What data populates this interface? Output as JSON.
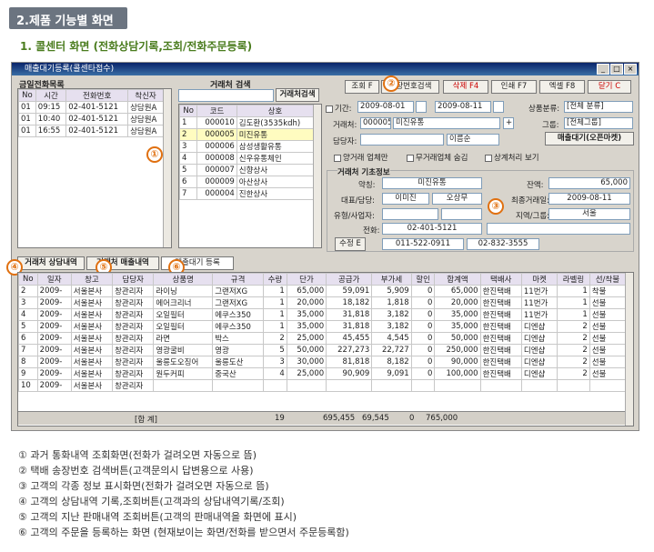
{
  "header": "2.제품 기능별 화면",
  "subtitle": "1. 콜센터 화면 (전화상담기록,조회/전화주문등록)",
  "window": {
    "title": "매출대기등록(콜센타접수)"
  },
  "calls": {
    "title": "금일전화목록",
    "cols": [
      "No",
      "시간",
      "전화번호",
      "착신자"
    ],
    "rows": [
      [
        "01",
        "09:15",
        "02-401-5121",
        "상담원A"
      ],
      [
        "01",
        "10:40",
        "02-401-5121",
        "상담원A"
      ],
      [
        "01",
        "16:55",
        "02-401-5121",
        "상담원A"
      ]
    ]
  },
  "search": {
    "title": "거래처 검색",
    "button": "거래처검색",
    "cols": [
      "No",
      "코드",
      "상호"
    ],
    "rows": [
      [
        "1",
        "000010",
        "김도환(3535kdh)"
      ],
      [
        "2",
        "000005",
        "미진유통"
      ],
      [
        "3",
        "000006",
        "삼성생활유통"
      ],
      [
        "4",
        "000008",
        "신우유통체인"
      ],
      [
        "5",
        "000007",
        "신향상사"
      ],
      [
        "6",
        "000009",
        "아산상사"
      ],
      [
        "7",
        "000004",
        "진한상사"
      ]
    ]
  },
  "toolbar": {
    "search": "조회 F",
    "tracking": "송장번호검색",
    "delete": "삭제 F4",
    "print": "인쇄 F7",
    "excel": "엑셀 F8",
    "close": "닫기 C"
  },
  "filters": {
    "period_label": "기간:",
    "date_from": "2009-08-01",
    "date_to": "2009-08-11",
    "category_label": "상품분류:",
    "category": "[전체 분류]",
    "client_label": "거래처:",
    "client_code": "000005",
    "client_name": "미진유통",
    "group_label": "그룹:",
    "group": "[전체그룹]",
    "manager_label": "담당자:",
    "sort": "이름순",
    "sales_btn": "매출대기(오픈마켓)",
    "chk1": "양거래 업체만",
    "chk2": "무거래업체 숨김",
    "chk3": "상계처리 보기"
  },
  "info": {
    "title": "거래처 기초정보",
    "short_label": "약칭:",
    "short": "미진유통",
    "balance_label": "잔액:",
    "balance": "65,000",
    "rep_label": "대표/담당:",
    "rep": "이미진",
    "staff": "오상무",
    "last_label": "최종거래일:",
    "last": "2009-08-11",
    "type_label": "유형/사업자:",
    "region_label": "지역/그룹:",
    "region": "서울",
    "phone_label": "전화:",
    "phone": "02-401-5121",
    "edit": "수정 E",
    "mobile": "011-522-0911",
    "fax": "02-832-3555"
  },
  "tabs": [
    "거래처 상담내역",
    "거래처 매출내역",
    "매출대기 등록"
  ],
  "grid": {
    "cols": [
      "No",
      "일자",
      "창고",
      "담당자",
      "상품명",
      "규격",
      "수량",
      "단가",
      "공급가",
      "부가세",
      "할인",
      "합계액",
      "택배사",
      "마켓",
      "라벨링",
      "선/착불"
    ],
    "rows": [
      [
        "2",
        "2009-",
        "서울본사",
        "창관리자",
        "라이닝",
        "그랜저XG",
        "1",
        "65,000",
        "59,091",
        "5,909",
        "0",
        "65,000",
        "한진택배",
        "11번가",
        "1",
        "착불"
      ],
      [
        "3",
        "2009-",
        "서울본사",
        "창관리자",
        "에어크리너",
        "그랜저XG",
        "1",
        "20,000",
        "18,182",
        "1,818",
        "0",
        "20,000",
        "한진택배",
        "11번가",
        "1",
        "선불"
      ],
      [
        "4",
        "2009-",
        "서울본사",
        "창관리자",
        "오일필터",
        "에쿠스350",
        "1",
        "35,000",
        "31,818",
        "3,182",
        "0",
        "35,000",
        "한진택배",
        "11번가",
        "1",
        "선불"
      ],
      [
        "5",
        "2009-",
        "서울본사",
        "창관리자",
        "오일필터",
        "에쿠스350",
        "1",
        "35,000",
        "31,818",
        "3,182",
        "0",
        "35,000",
        "한진택배",
        "디엔샵",
        "2",
        "선불"
      ],
      [
        "6",
        "2009-",
        "서울본사",
        "창관리자",
        "라면",
        "박스",
        "2",
        "25,000",
        "45,455",
        "4,545",
        "0",
        "50,000",
        "한진택배",
        "디엔샵",
        "2",
        "선불"
      ],
      [
        "7",
        "2009-",
        "서울본사",
        "창관리자",
        "영광굴비",
        "영광",
        "5",
        "50,000",
        "227,273",
        "22,727",
        "0",
        "250,000",
        "한진택배",
        "디엔샵",
        "2",
        "선불"
      ],
      [
        "8",
        "2009-",
        "서울본사",
        "창관리자",
        "울릉도오징어",
        "울릉도산",
        "3",
        "30,000",
        "81,818",
        "8,182",
        "0",
        "90,000",
        "한진택배",
        "디엔샵",
        "2",
        "선불"
      ],
      [
        "9",
        "2009-",
        "서울본사",
        "창관리자",
        "원두커피",
        "중국산",
        "4",
        "25,000",
        "90,909",
        "9,091",
        "0",
        "100,000",
        "한진택배",
        "디엔샵",
        "2",
        "선불"
      ],
      [
        "10",
        "2009-",
        "서울본사",
        "창관리자",
        "",
        "",
        "",
        "",
        "",
        "",
        "",
        "",
        "",
        "",
        "",
        ""
      ]
    ],
    "total_label": "[합 계]",
    "total_qty": "19",
    "total_supply": "695,455",
    "total_vat": "69,545",
    "total_dc": "0",
    "total_sum": "765,000"
  },
  "notes": [
    "① 과거 통화내역 조회화면(전화가 걸려오면 자동으로 뜸)",
    "② 택배 송장번호 검색버튼(고객문의시 답변용으로 사용)",
    "③ 고객의 각종 정보 표시화면(전화가 걸려오면 자동으로 뜸)",
    "④ 고객의 상담내역 기록,조회버튼(고객과의 상담내역기록/조회)",
    "⑤ 고객의 지난 판매내역 조회버튼(고객의 판매내역을 화면에 표시)",
    "⑥ 고객의 주문을 등록하는 화면 (현재보이는 화면/전화를 받으면서 주문등록함)"
  ],
  "markers": [
    "①",
    "②",
    "③",
    "④",
    "⑤",
    "⑥"
  ]
}
